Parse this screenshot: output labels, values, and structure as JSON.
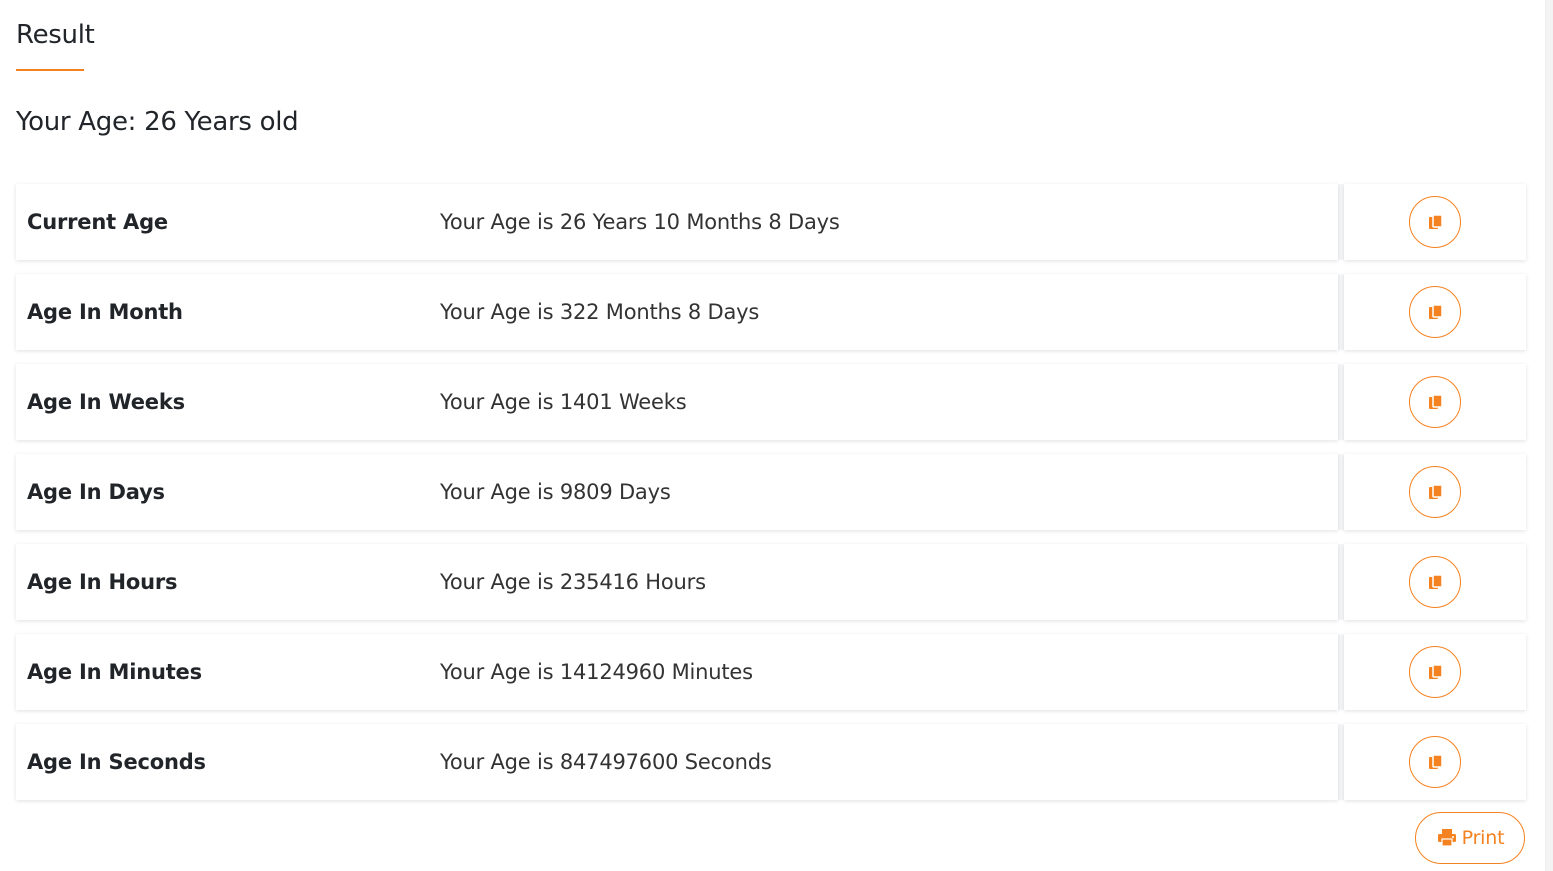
{
  "header": {
    "title": "Result",
    "age_summary": "Your Age: 26 Years old"
  },
  "results": [
    {
      "label": "Current Age",
      "value": "Your Age is 26 Years 10 Months 8 Days",
      "action_icon": "copy-icon"
    },
    {
      "label": "Age In Month",
      "value": "Your Age is 322 Months 8 Days",
      "action_icon": "copy-icon"
    },
    {
      "label": "Age In Weeks",
      "value": "Your Age is 1401 Weeks",
      "action_icon": "copy-icon"
    },
    {
      "label": "Age In Days",
      "value": "Your Age is 9809 Days",
      "action_icon": "copy-icon"
    },
    {
      "label": "Age In Hours",
      "value": "Your Age is 235416 Hours",
      "action_icon": "copy-icon"
    },
    {
      "label": "Age In Minutes",
      "value": "Your Age is 14124960 Minutes",
      "action_icon": "copy-icon"
    },
    {
      "label": "Age In Seconds",
      "value": "Your Age is 847497600 Seconds",
      "action_icon": "copy-icon"
    }
  ],
  "print_button": {
    "label": "Print",
    "icon": "printer-icon"
  },
  "colors": {
    "accent": "#f58220",
    "text": "#212529",
    "card_background": "#ffffff"
  }
}
